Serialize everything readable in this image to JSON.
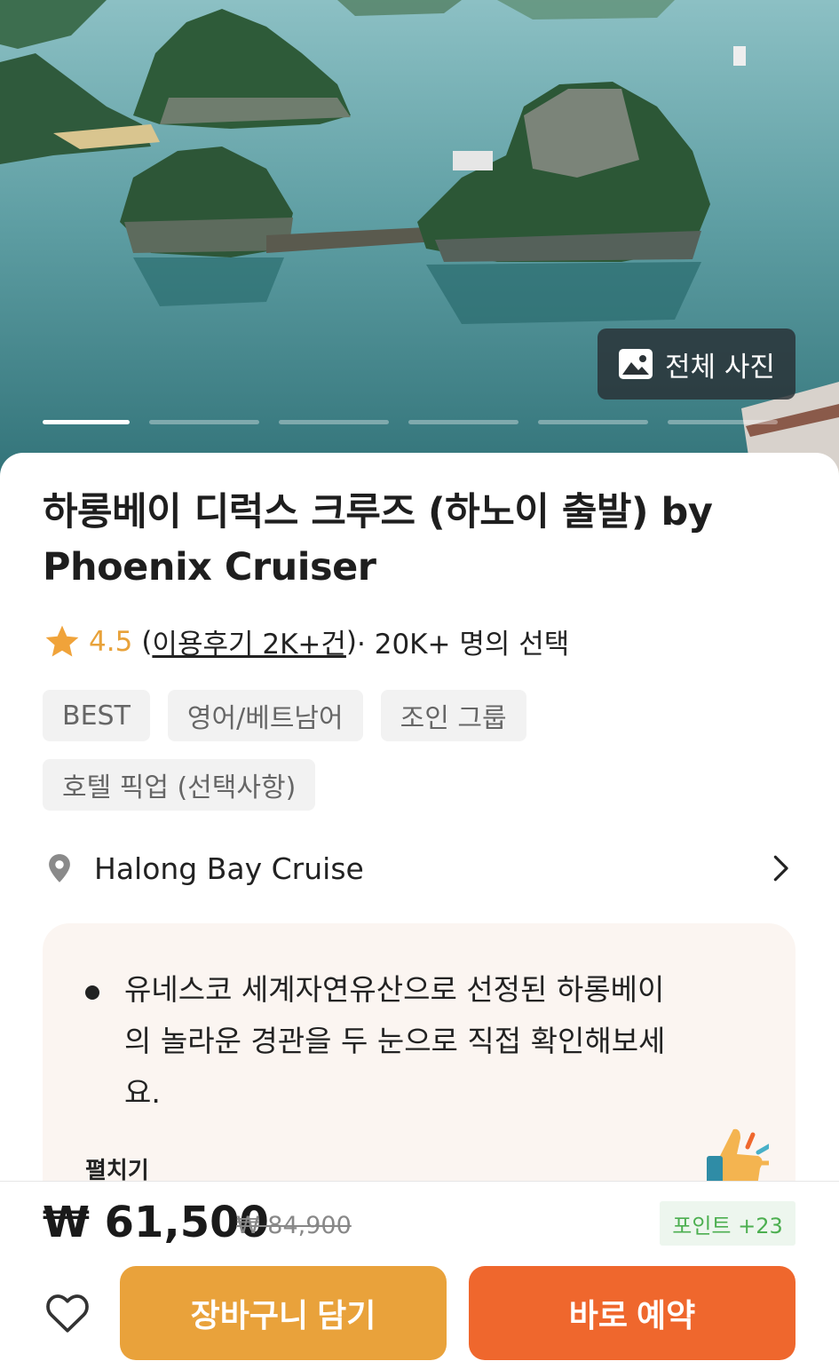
{
  "hero": {
    "all_photos_label": "전체 사진",
    "indicator_count": 6,
    "active_index": 0
  },
  "product": {
    "title": "하롱베이 디럭스 크루즈 (하노이 출발) by Phoenix Cruiser",
    "rating": "4.5",
    "review_open": "(",
    "review_text": "이용후기 2K+건",
    "review_close": ")",
    "chosen_text": " · 20K+ 명의 선택",
    "tags": [
      "BEST",
      "영어/베트남어",
      "조인 그룹",
      "호텔 픽업 (선택사항)"
    ],
    "location": "Halong Bay Cruise",
    "highlight": "유네스코 세계자연유산으로 선정된 하롱베이의 놀라운 경관을 두 눈으로 직접 확인해보세요.",
    "expand_label": "펼치기"
  },
  "bottom_bar": {
    "price": "₩ 61,500",
    "original_price": "₩ 84,900",
    "points": "포인트 +23",
    "cart_label": "장바구니 담기",
    "book_label": "바로 예약"
  },
  "colors": {
    "star": "#f0a33a",
    "cart_button": "#e9a23b",
    "book_button": "#ef672d",
    "points_text": "#4caf50"
  }
}
